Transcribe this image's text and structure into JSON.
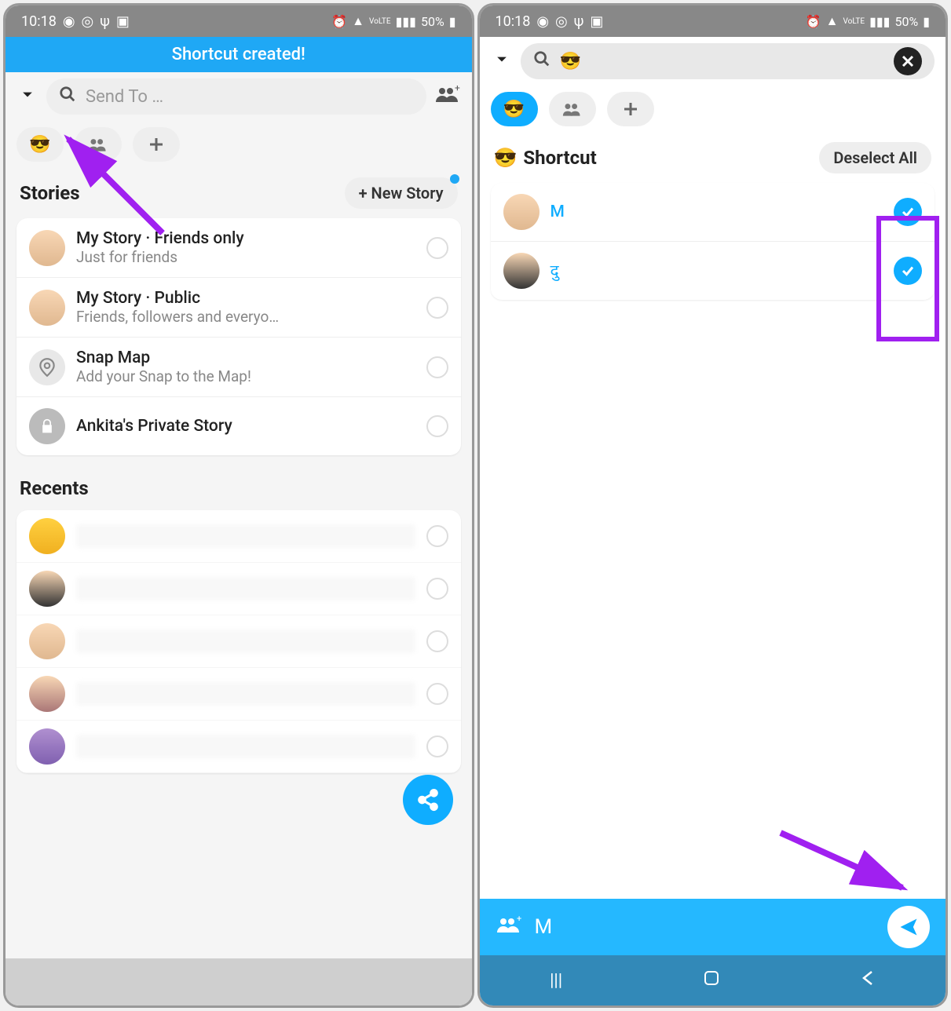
{
  "statusbar": {
    "time": "10:18",
    "battery": "50%"
  },
  "left": {
    "banner": "Shortcut created!",
    "search_placeholder": "Send To …",
    "stories_label": "Stories",
    "new_story_label": "+ New Story",
    "story_items": [
      {
        "title": "My Story · Friends only",
        "sub": "Just for friends"
      },
      {
        "title": "My Story · Public",
        "sub": "Friends, followers and everyo…"
      },
      {
        "title": "Snap Map",
        "sub": "Add your Snap to the Map!"
      },
      {
        "title": "Ankita's Private Story",
        "sub": ""
      }
    ],
    "recents_label": "Recents"
  },
  "right": {
    "shortcut_label": "Shortcut",
    "deselect_label": "Deselect All",
    "members": [
      {
        "name": "M"
      },
      {
        "name": "दु"
      }
    ],
    "send_preview": "M"
  },
  "emoji": {
    "sunglasses": "😎"
  }
}
